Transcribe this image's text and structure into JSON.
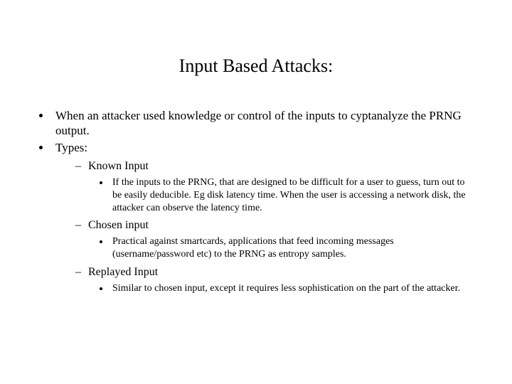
{
  "title": "Input Based Attacks:",
  "bullets": {
    "intro": "When an attacker used knowledge or control of the inputs to cyptanalyze the PRNG output.",
    "typesLabel": "Types:",
    "types": {
      "known": {
        "heading": "Known Input",
        "detail": "If the inputs to the PRNG, that are designed to be difficult for a user to guess, turn out to be easily deducible. Eg disk latency time. When the user is accessing a network disk, the attacker can observe the latency time."
      },
      "chosen": {
        "heading": "Chosen input",
        "detail": "Practical against smartcards, applications that feed incoming messages (username/password etc) to the PRNG as entropy samples."
      },
      "replayed": {
        "heading": "Replayed Input",
        "detail": "Similar to chosen input, except it requires less sophistication on the part of the attacker."
      }
    }
  }
}
